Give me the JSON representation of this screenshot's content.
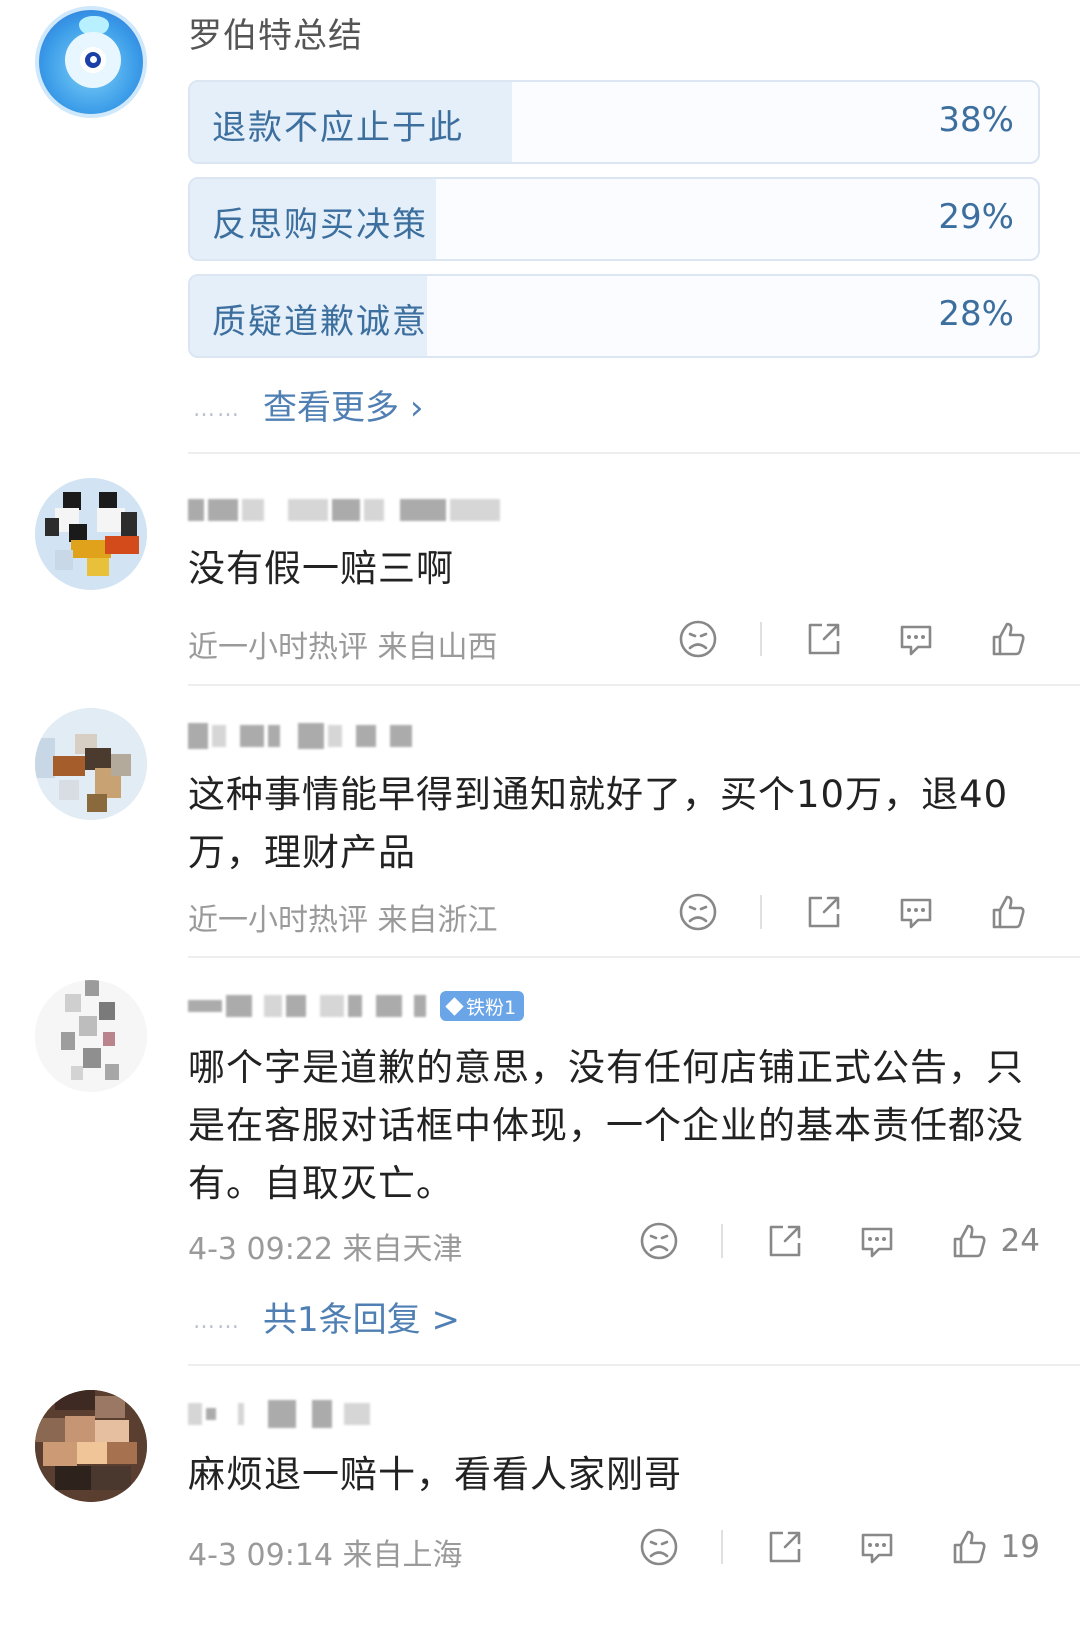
{
  "summary": {
    "title": "罗伯特总结",
    "poll": [
      {
        "label": "退款不应止于此",
        "percent": "38%",
        "fraction": 0.38
      },
      {
        "label": "反思购买决策",
        "percent": "29%",
        "fraction": 0.29
      },
      {
        "label": "质疑道歉诚意",
        "percent": "28%",
        "fraction": 0.28
      }
    ],
    "more_label": "查看更多",
    "more_chevron": "›",
    "dots": "……"
  },
  "comments": [
    {
      "text": "没有假一赔三啊",
      "meta": "近一小时热评  来自山西",
      "likes": ""
    },
    {
      "text": "这种事情能早得到通知就好了，买个10万，退40万，理财产品",
      "meta": "近一小时热评  来自浙江",
      "likes": ""
    },
    {
      "badge": "铁粉1",
      "text": "哪个字是道歉的意思，没有任何店铺正式公告，只是在客服对话框中体现，一个企业的基本责任都没有。自取灭亡。",
      "meta": "4-3 09:22  来自天津",
      "likes": "24",
      "replies_label": "共1条回复 >"
    },
    {
      "text": "麻烦退一赔十，看看人家刚哥",
      "meta": "4-3 09:14  来自上海",
      "likes": "19"
    }
  ],
  "icons": {
    "dislike": "frown-icon",
    "share": "share-icon",
    "comment": "comment-icon",
    "like": "thumbs-up-icon"
  },
  "colors": {
    "link": "#4f7fb3",
    "poll_fill": "#e4eff9",
    "badge": "#6aa5e8",
    "meta": "#9a9a9a"
  }
}
